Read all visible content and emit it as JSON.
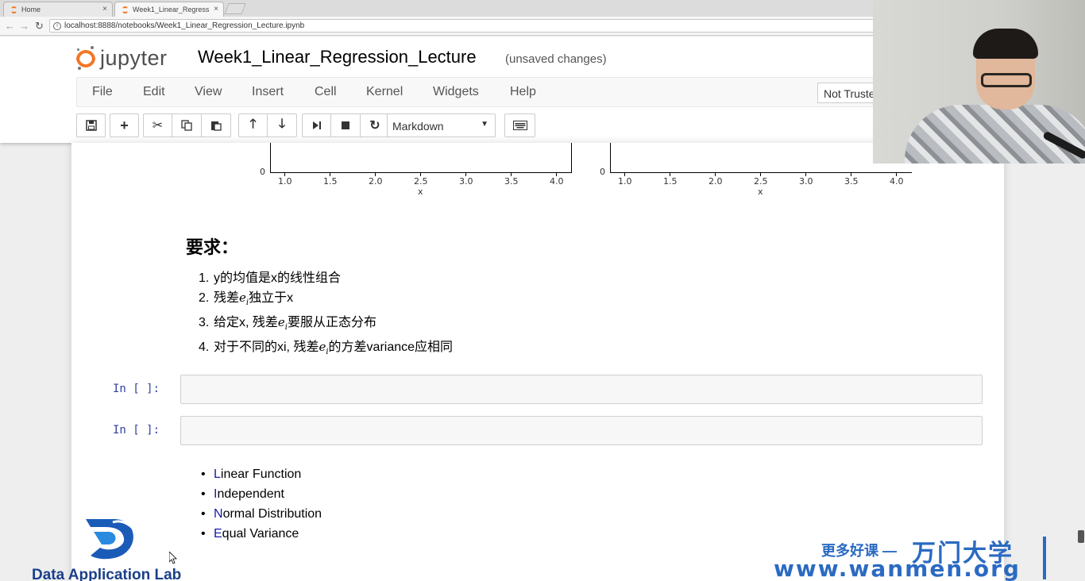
{
  "browser": {
    "tabs": [
      {
        "title": "Home"
      },
      {
        "title": "Week1_Linear_Regress"
      }
    ],
    "url": "localhost:8888/notebooks/Week1_Linear_Regression_Lecture.ipynb"
  },
  "header": {
    "logo_text": "jupyter",
    "notebook_title": "Week1_Linear_Regression_Lecture",
    "save_status": "(unsaved changes)",
    "trust_label": "Not Truste"
  },
  "menu": {
    "items": [
      "File",
      "Edit",
      "View",
      "Insert",
      "Cell",
      "Kernel",
      "Widgets",
      "Help"
    ]
  },
  "toolbar": {
    "cell_type": "Markdown",
    "icons": [
      "save-icon",
      "plus-icon",
      "scissors-icon",
      "copy-icon",
      "paste-icon",
      "arrow-up-icon",
      "arrow-down-icon",
      "step-forward-icon",
      "stop-icon",
      "restart-icon",
      "keyboard-icon"
    ]
  },
  "plots": [
    {
      "y_tick": "0",
      "x_ticks": [
        "1.0",
        "1.5",
        "2.0",
        "2.5",
        "3.0",
        "3.5",
        "4.0"
      ],
      "xlabel": "x"
    },
    {
      "y_tick": "0",
      "x_ticks": [
        "1.0",
        "1.5",
        "2.0",
        "2.5",
        "3.0",
        "3.5",
        "4.0"
      ],
      "xlabel": "x"
    }
  ],
  "requirements": {
    "heading": "要求：",
    "items": [
      {
        "num": "1.",
        "before": "y的均值是x的线性组合",
        "has_ei": false,
        "after": ""
      },
      {
        "num": "2.",
        "before": "残差",
        "has_ei": true,
        "after": "独立于x"
      },
      {
        "num": "3.",
        "before": "给定x, 残差",
        "has_ei": true,
        "after": "要服从正态分布"
      },
      {
        "num": "4.",
        "before": "对于不同的xi, 残差",
        "has_ei": true,
        "after": "的方差variance应相同"
      }
    ],
    "ei_base": "e",
    "ei_sub": "i"
  },
  "code_cells": [
    {
      "prompt": "In [ ]:"
    },
    {
      "prompt": "In [ ]:"
    }
  ],
  "line_list": [
    {
      "initial": "L",
      "rest": "inear Function"
    },
    {
      "initial": "I",
      "rest": "ndependent"
    },
    {
      "initial": "N",
      "rest": "ormal Distribution"
    },
    {
      "initial": "E",
      "rest": "qual Variance"
    }
  ],
  "overlays": {
    "dal_text": "Data Application Lab",
    "wm_tagline": "更多好课 —",
    "wm_brand": "万门大学",
    "wm_url": "www.wanmen.org"
  },
  "colors": {
    "jupyter_orange": "#f37726",
    "prompt_blue": "#303f9f",
    "wanmen_blue": "#2b6ac2",
    "dal_blue": "#1a3f8a"
  }
}
